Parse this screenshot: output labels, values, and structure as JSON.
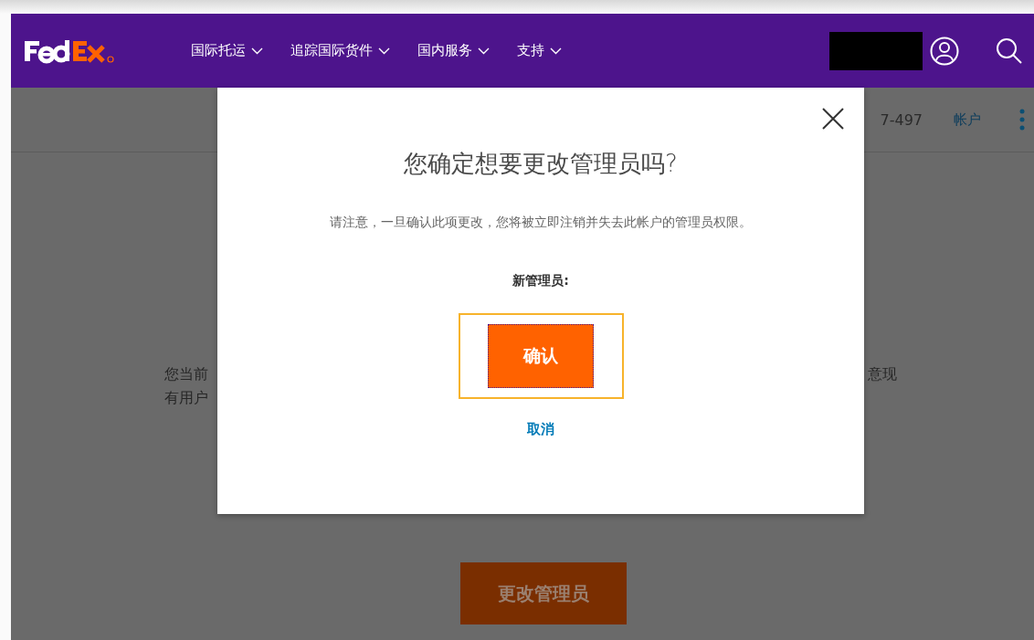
{
  "nav": {
    "items": [
      {
        "label": "国际托运"
      },
      {
        "label": "追踪国际货件"
      },
      {
        "label": "国内服务"
      },
      {
        "label": "支持"
      }
    ]
  },
  "subheader": {
    "account_number": "7-497",
    "account_link": "帐户"
  },
  "background": {
    "left_lines": [
      "您当前",
      "有用户"
    ],
    "right_line": "意现",
    "button": "更改管理员"
  },
  "dialog": {
    "title": "您确定想要更改管理员吗?",
    "note": "请注意，一旦确认此项更改，您将被立即注销并失去此帐户的管理员权限。",
    "label": "新管理员:",
    "confirm": "确认",
    "confirm_focused": true,
    "cancel": "取消"
  }
}
